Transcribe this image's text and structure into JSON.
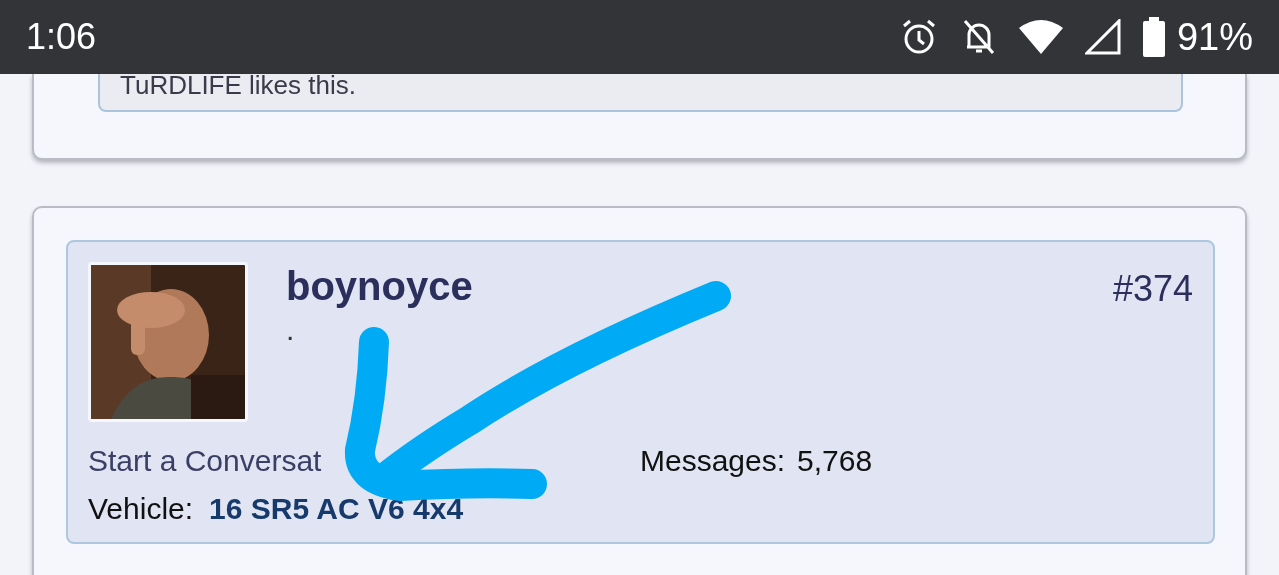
{
  "status_bar": {
    "time": "1:06",
    "battery": "91%"
  },
  "previous_post": {
    "likes": "TuRDLIFE likes this."
  },
  "post": {
    "username": "boynoyce",
    "user_title": ".",
    "number": "#374",
    "start_conversation": "Start a Conversat",
    "messages_label": "Messages:",
    "messages_value": "5,768",
    "vehicle_label": "Vehicle:",
    "vehicle_value": "16 SR5 AC V6 4x4"
  }
}
